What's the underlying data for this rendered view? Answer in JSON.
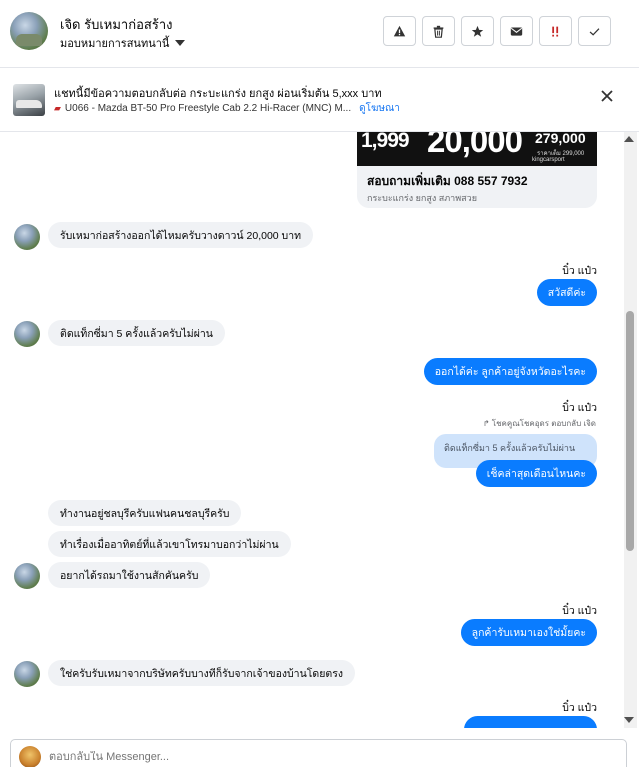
{
  "header": {
    "name": "เจิด รับเหมาก่อสร้าง",
    "assign_label": "มอบหมายการสนทนานี้",
    "toolbar": [
      "warning-icon",
      "trash-icon",
      "star-icon",
      "mail-icon",
      "urgent-icon",
      "check-icon"
    ],
    "urgent_color": "#c62828"
  },
  "adbar": {
    "title": "แชทนี้มีข้อความตอบกลับต่อ กระบะแกร่ง ยกสูง ผ่อนเริ่มต้น 5,xxx บาท",
    "subtitle": "U066 - Mazda BT-50 Pro Freestyle Cab 2.2 Hi-Racer (MNC) M...",
    "link": "ดูโฆษณา"
  },
  "ad_card": {
    "price_1": "1,999",
    "price_2": "20,000",
    "price_3": "279,000",
    "price_note": "ราคาเต็ม 299,000",
    "logo_text": "kingcarsport",
    "phone_line": "สอบถามเพิ่มเติม 088 557 7932",
    "note": "กระบะแกร่ง ยกสูง สภาพสวย"
  },
  "messages": {
    "m1": "รับเหมาก่อสร้างออกได้ไหมครับวางดาวน์ 20,000 บาท",
    "s1": "บิ๋ว แป๋ว",
    "m2": "สวัสดีค่ะ",
    "m3": "ติดแท็กซี่มา 5 ครั้งแล้วครับไม่ผ่าน",
    "m4": "ออกได้ค่ะ ลูกค้าอยู่จังหวัดอะไรคะ",
    "s2": "บิ๋ว แป๋ว",
    "reply_hint": "โชคคูณโชคอุดร ตอบกลับ เจิด",
    "quoted": "ติดแท็กซี่มา 5 ครั้งแล้วครับไม่ผ่าน",
    "m5": "เช็คล่าสุดเดือนไหนคะ",
    "m6": "ทำงานอยู่ชลบุรีครับแฟนคนชลบุรีครับ",
    "m7": "ทำเรื่องเมื่ออาทิตย์ที่แล้วเขาโทรมาบอกว่าไม่ผ่าน",
    "m8": "อยากได้รถมาใช้งานสักคันครับ",
    "s3": "บิ๋ว แป๋ว",
    "m9": "ลูกค้ารับเหมาเองใช่มั้ยคะ",
    "m10": "ใช่ครับรับเหมาจากบริษัทครับบางทีก็รับจากเจ้าของบ้านโดยตรง",
    "s4": "บิ๋ว แป๋ว"
  },
  "composer": {
    "placeholder": "ตอบกลับใน Messenger..."
  }
}
